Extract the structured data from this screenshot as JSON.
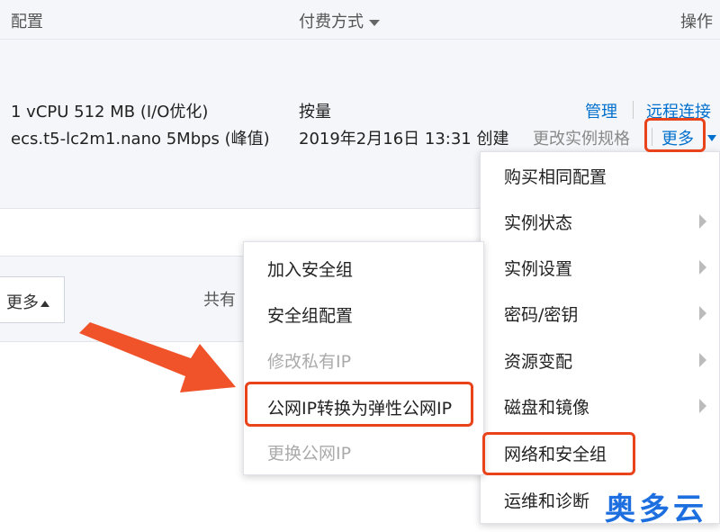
{
  "table": {
    "columns": {
      "config": "配置",
      "billing": "付费方式",
      "actions": "操作"
    },
    "row": {
      "spec_line1": "1 vCPU 512 MB (I/O优化)",
      "spec_line2": "ecs.t5-lc2m1.nano   5Mbps (峰值)",
      "billing_type": "按量",
      "created": "2019年2月16日 13:31 创建",
      "action_manage": "管理",
      "action_remote": "远程连接",
      "action_change_spec": "更改实例规格",
      "action_more": "更多"
    }
  },
  "footer": {
    "more_button": "更多",
    "total_prefix": "共有"
  },
  "main_menu": {
    "items": [
      {
        "label": "购买相同配置",
        "submenu": false
      },
      {
        "label": "实例状态",
        "submenu": true
      },
      {
        "label": "实例设置",
        "submenu": true
      },
      {
        "label": "密码/密钥",
        "submenu": true
      },
      {
        "label": "资源变配",
        "submenu": true
      },
      {
        "label": "磁盘和镜像",
        "submenu": true
      },
      {
        "label": "网络和安全组",
        "submenu": false
      },
      {
        "label": "运维和诊断",
        "submenu": false
      }
    ]
  },
  "sub_menu": {
    "items": [
      {
        "label": "加入安全组",
        "disabled": false
      },
      {
        "label": "安全组配置",
        "disabled": false
      },
      {
        "label": "修改私有IP",
        "disabled": true
      },
      {
        "label": "公网IP转换为弹性公网IP",
        "disabled": false
      },
      {
        "label": "更换公网IP",
        "disabled": true
      }
    ]
  },
  "watermark": "奥多云",
  "colors": {
    "link": "#0070cc",
    "highlight": "#e8431a",
    "arrow": "#f0522a",
    "brand": "#1d6fe0"
  }
}
